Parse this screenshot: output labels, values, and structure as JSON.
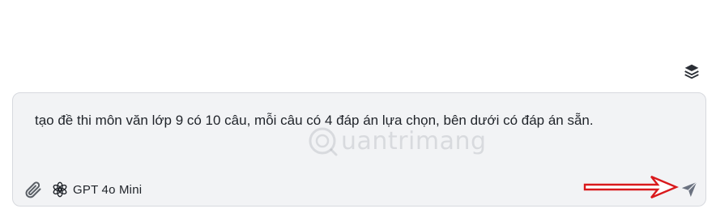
{
  "composer": {
    "prompt_text": "tạo đề thi môn văn lớp 9 có 10 câu, mỗi câu có 4 đáp án lựa chọn, bên dưới có đáp án sẵn.",
    "model_name": "GPT 4o Mini"
  },
  "icons": {
    "layers": "layers-icon",
    "attach": "paperclip-icon",
    "model": "openai-logo-icon",
    "send": "send-icon",
    "annotation": "red-arrow-icon"
  },
  "watermark": {
    "text": "uantrimang"
  },
  "colors": {
    "composer_background": "#f2f3f5",
    "composer_border": "#d7d9de",
    "text": "#1f2329",
    "send_icon": "#6b7280",
    "annotation_arrow": "#d9191c"
  }
}
